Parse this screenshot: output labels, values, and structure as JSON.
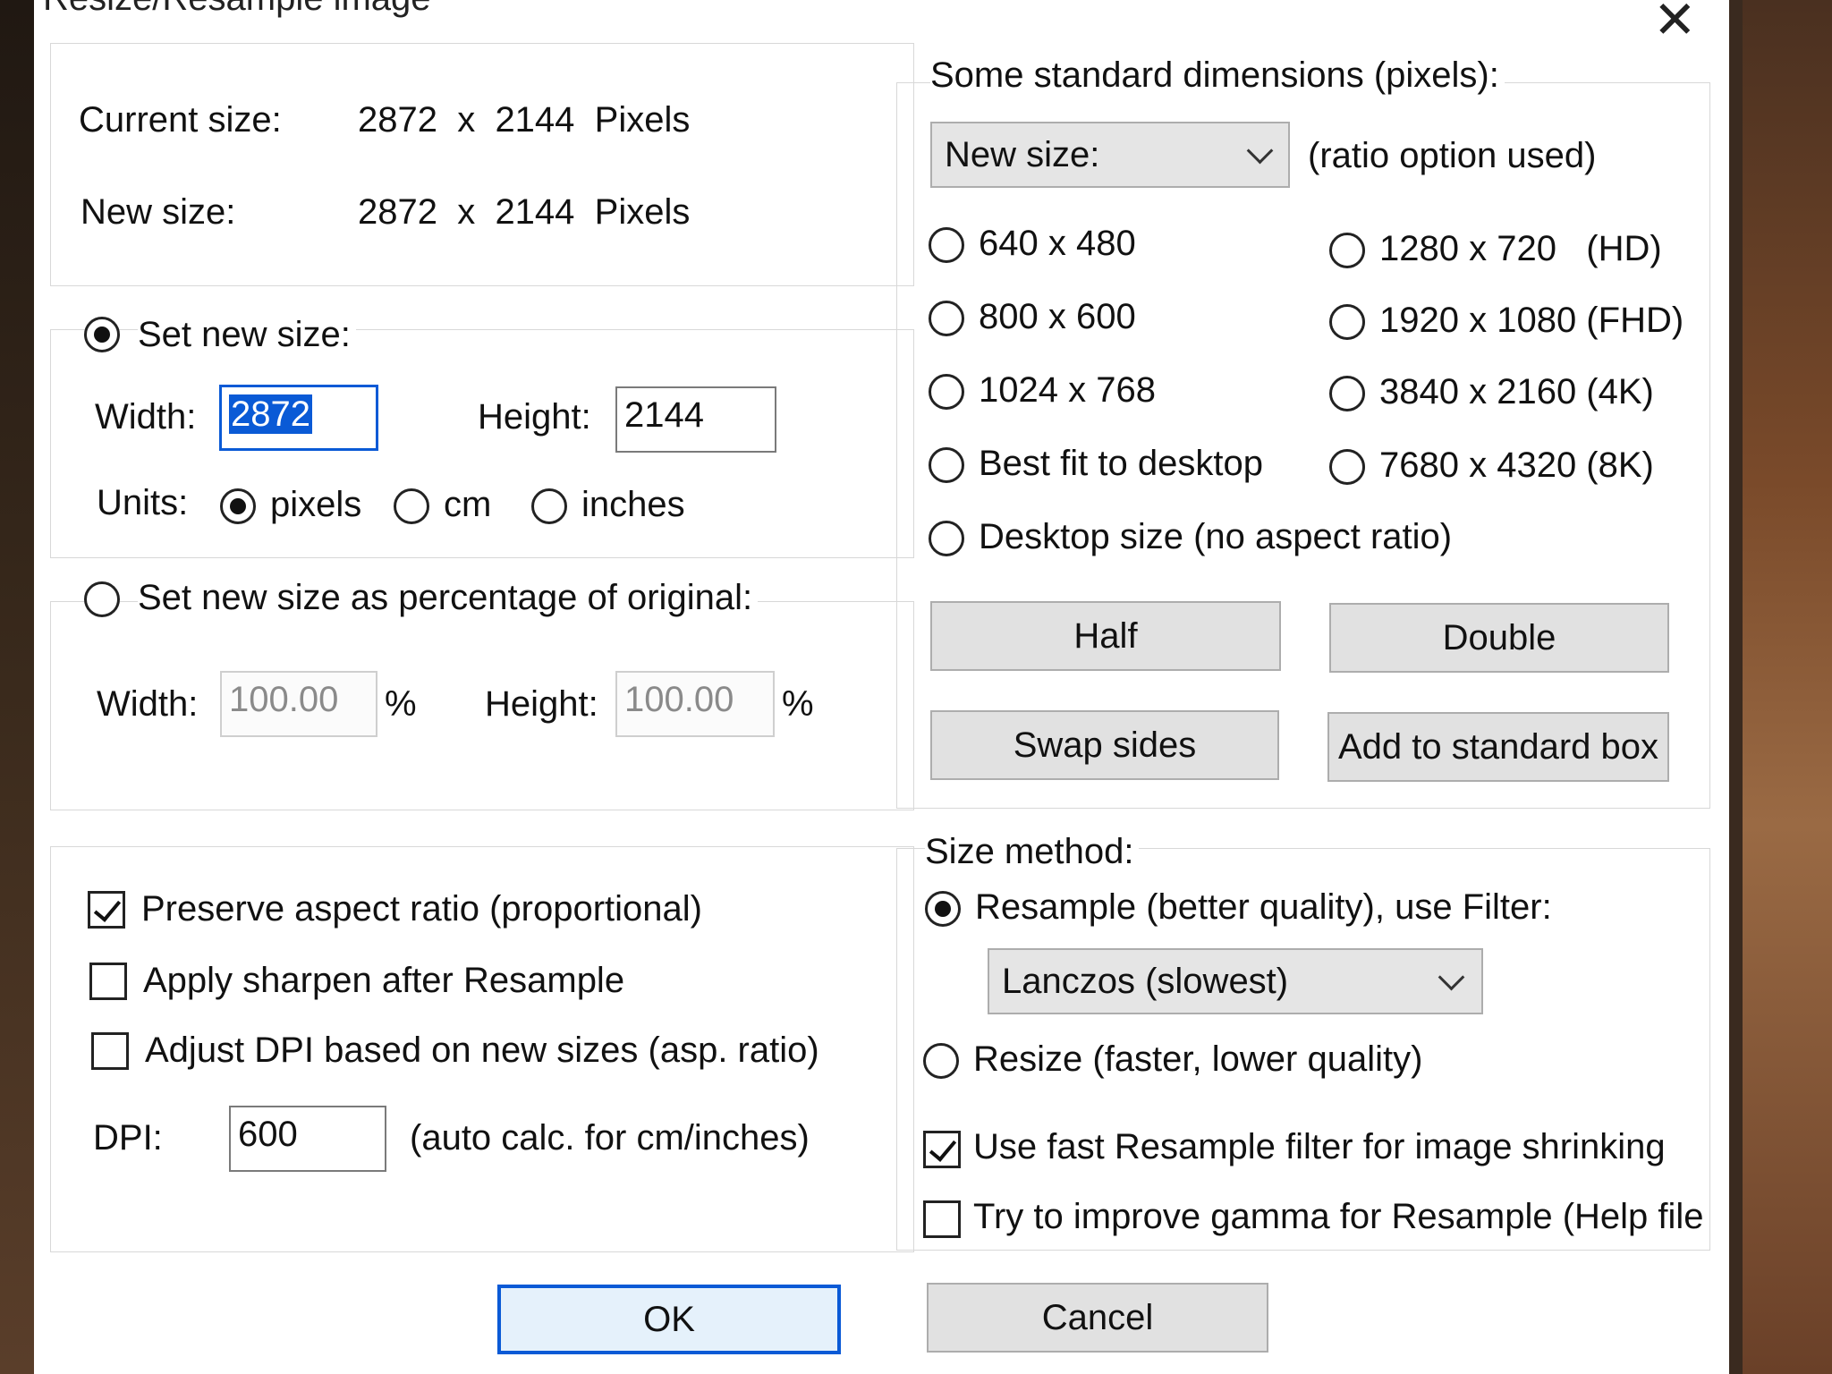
{
  "window": {
    "title_fragment": "Resize/Resample image",
    "close_glyph": "✕"
  },
  "current": {
    "label": "Current size:",
    "value": "2872  x  2144  Pixels"
  },
  "newsize": {
    "label": "New size:",
    "value": "2872  x  2144  Pixels"
  },
  "set_new_size": {
    "label": "Set new size:",
    "width_label": "Width:",
    "width_value": "2872",
    "height_label": "Height:",
    "height_value": "2144",
    "units_label": "Units:",
    "units": [
      "pixels",
      "cm",
      "inches"
    ]
  },
  "percentage": {
    "label": "Set new size as percentage of original:",
    "width_label": "Width:",
    "width_value": "100.00",
    "height_label": "Height:",
    "height_value": "100.00",
    "pct": "%"
  },
  "options": {
    "preserve": "Preserve aspect ratio (proportional)",
    "sharpen": "Apply sharpen after Resample",
    "adjust_dpi": "Adjust DPI based on new sizes (asp. ratio)",
    "dpi_label": "DPI:",
    "dpi_value": "600",
    "dpi_note": "(auto calc. for cm/inches)"
  },
  "standard": {
    "label": "Some standard dimensions (pixels):",
    "combo_value": "New size:",
    "ratio_note": "(ratio option used)",
    "radios": [
      "640 x 480",
      "1280 x 720   (HD)",
      "800 x 600",
      "1920 x 1080 (FHD)",
      "1024 x 768",
      "3840 x 2160 (4K)",
      "Best fit to desktop",
      "7680 x 4320 (8K)",
      "Desktop size (no aspect ratio)"
    ]
  },
  "buttons": {
    "half": "Half",
    "double": "Double",
    "swap": "Swap sides",
    "add": "Add to standard box",
    "ok": "OK",
    "cancel": "Cancel"
  },
  "method": {
    "label": "Size method:",
    "resample": "Resample (better quality), use Filter:",
    "filter": "Lanczos (slowest)",
    "resize": "Resize (faster, lower quality)",
    "fast_filter": "Use fast Resample filter for image shrinking",
    "gamma": "Try to improve gamma for Resample (Help file"
  }
}
